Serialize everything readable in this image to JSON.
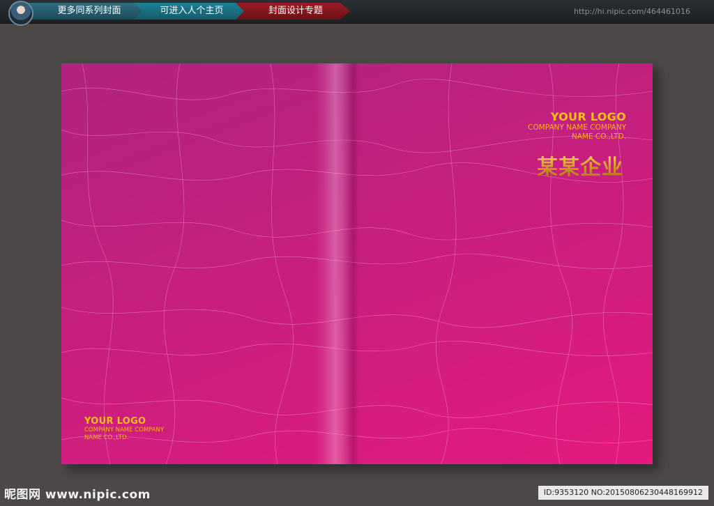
{
  "nav": {
    "tabs": [
      {
        "label": "更多同系列封面"
      },
      {
        "label": "可进入人个主页"
      },
      {
        "label": "封面设计专题"
      }
    ],
    "url": "http://hi.nipic.com/464461016"
  },
  "cover": {
    "colors": {
      "background": "#c2207f",
      "gold": "#f4c21a",
      "page": "#4b4847"
    },
    "front": {
      "logo": "YOUR LOGO",
      "company_line1": "COMPANY NAME COMPANY",
      "company_line2": "NAME CO.,LTD.",
      "title": "某某企业"
    },
    "back": {
      "logo": "YOUR LOGO",
      "company_line1": "COMPANY NAME COMPANY",
      "company_line2": "NAME CO.,LTD."
    }
  },
  "footer": {
    "site": "昵图网 www.nipic.com",
    "id_line": "ID:9353120 NO:20150806230448169912"
  }
}
